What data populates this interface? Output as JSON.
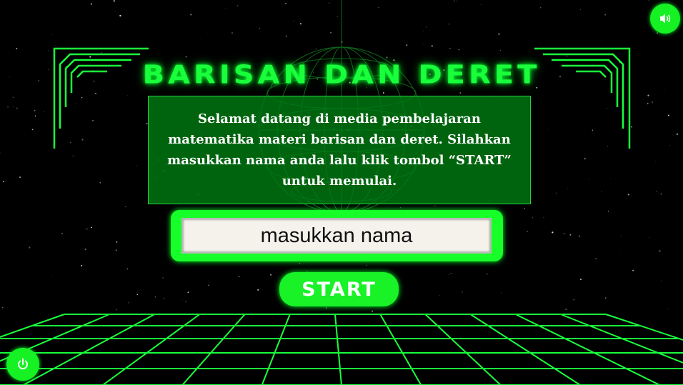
{
  "game": {
    "title": "BARISAN DAN DERET",
    "intro": "Selamat datang di media pembelajaran matematika materi barisan dan deret. Silahkan masukkan nama anda lalu klik tombol “START” untuk memulai.",
    "name_input": {
      "placeholder": "masukkan nama",
      "value": ""
    },
    "start_label": "START"
  },
  "controls": {
    "sound_icon": "speaker-volume-icon",
    "power_icon": "power-icon"
  },
  "colors": {
    "neon_green": "#1aff3c",
    "button_green": "#18f227",
    "panel_green": "#007a12",
    "background": "#000000"
  }
}
